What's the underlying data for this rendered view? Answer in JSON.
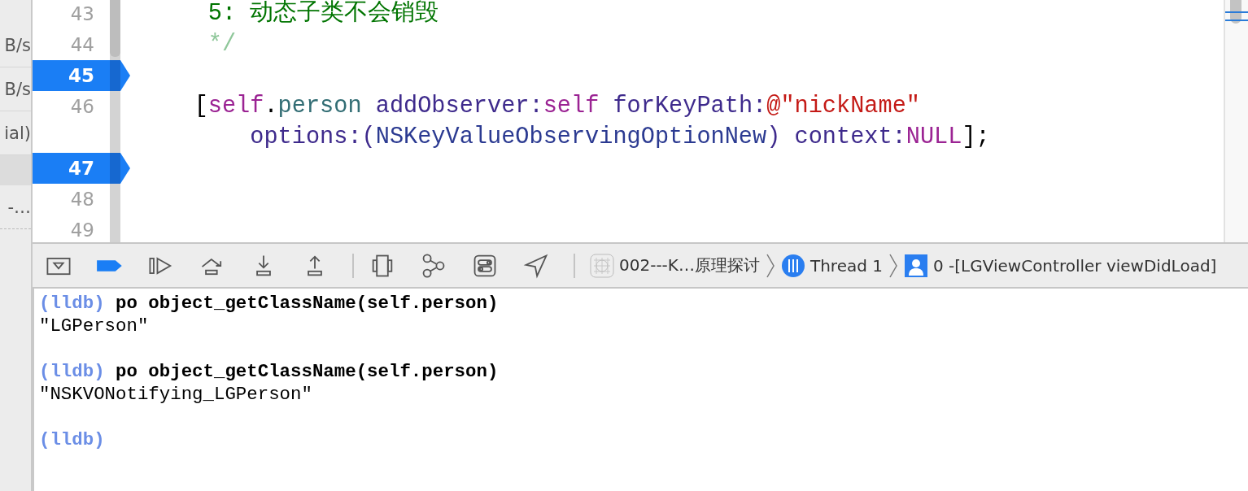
{
  "sidebar": {
    "items": [
      {
        "text": "B/s",
        "selected": false
      },
      {
        "text": "B/s",
        "selected": false
      },
      {
        "text": "ial)",
        "selected": false
      },
      {
        "selected": true
      },
      {
        "text": "-…",
        "selected": false
      }
    ]
  },
  "editor": {
    "lines": [
      {
        "number": "43",
        "breakpoint": false,
        "segments": [
          {
            "text": "     5: 动态子类不会销毁",
            "kind": "comment"
          }
        ]
      },
      {
        "number": "44",
        "breakpoint": false,
        "segments": [
          {
            "text": "     */",
            "kind": "comment_light"
          }
        ]
      },
      {
        "number": "45",
        "breakpoint": true
      },
      {
        "number": "46",
        "breakpoint": false,
        "segments": [
          {
            "text": "    [",
            "kind": "plain"
          },
          {
            "text": "self",
            "kind": "keyword"
          },
          {
            "text": ".",
            "kind": "plain"
          },
          {
            "text": "person",
            "kind": "property"
          },
          {
            "text": " addObserver:",
            "kind": "method"
          },
          {
            "text": "self",
            "kind": "keyword"
          },
          {
            "text": " forKeyPath:",
            "kind": "method"
          },
          {
            "text": "@\"nickName\"",
            "kind": "string"
          },
          {
            "kind": "wrap"
          },
          {
            "text": "        options:(",
            "kind": "method"
          },
          {
            "text": "NSKeyValueObservingOptionNew",
            "kind": "type"
          },
          {
            "text": ") context:",
            "kind": "method"
          },
          {
            "text": "NULL",
            "kind": "keyword"
          },
          {
            "text": "];",
            "kind": "plain"
          }
        ]
      },
      {
        "number": "47",
        "breakpoint": true
      },
      {
        "number": "48",
        "breakpoint": false
      },
      {
        "number": "49",
        "breakpoint": false
      }
    ]
  },
  "debug_bar": {
    "breakpoints_active": true,
    "breadcrumbs": [
      {
        "kind": "app",
        "text": "002---K…原理探讨"
      },
      {
        "kind": "thread",
        "text": "Thread 1"
      },
      {
        "kind": "frame",
        "text": "0 -[LGViewController viewDidLoad]"
      }
    ]
  },
  "console": {
    "lines": [
      {
        "kind": "command",
        "prompt": "(lldb)",
        "text": "po object_getClassName(self.person)"
      },
      {
        "kind": "output",
        "text": "\"LGPerson\""
      },
      {
        "kind": "blank"
      },
      {
        "kind": "command",
        "prompt": "(lldb)",
        "text": "po object_getClassName(self.person)"
      },
      {
        "kind": "output",
        "text": "\"NSKVONotifying_LGPerson\""
      },
      {
        "kind": "blank"
      },
      {
        "kind": "prompt",
        "prompt": "(lldb)"
      }
    ]
  }
}
